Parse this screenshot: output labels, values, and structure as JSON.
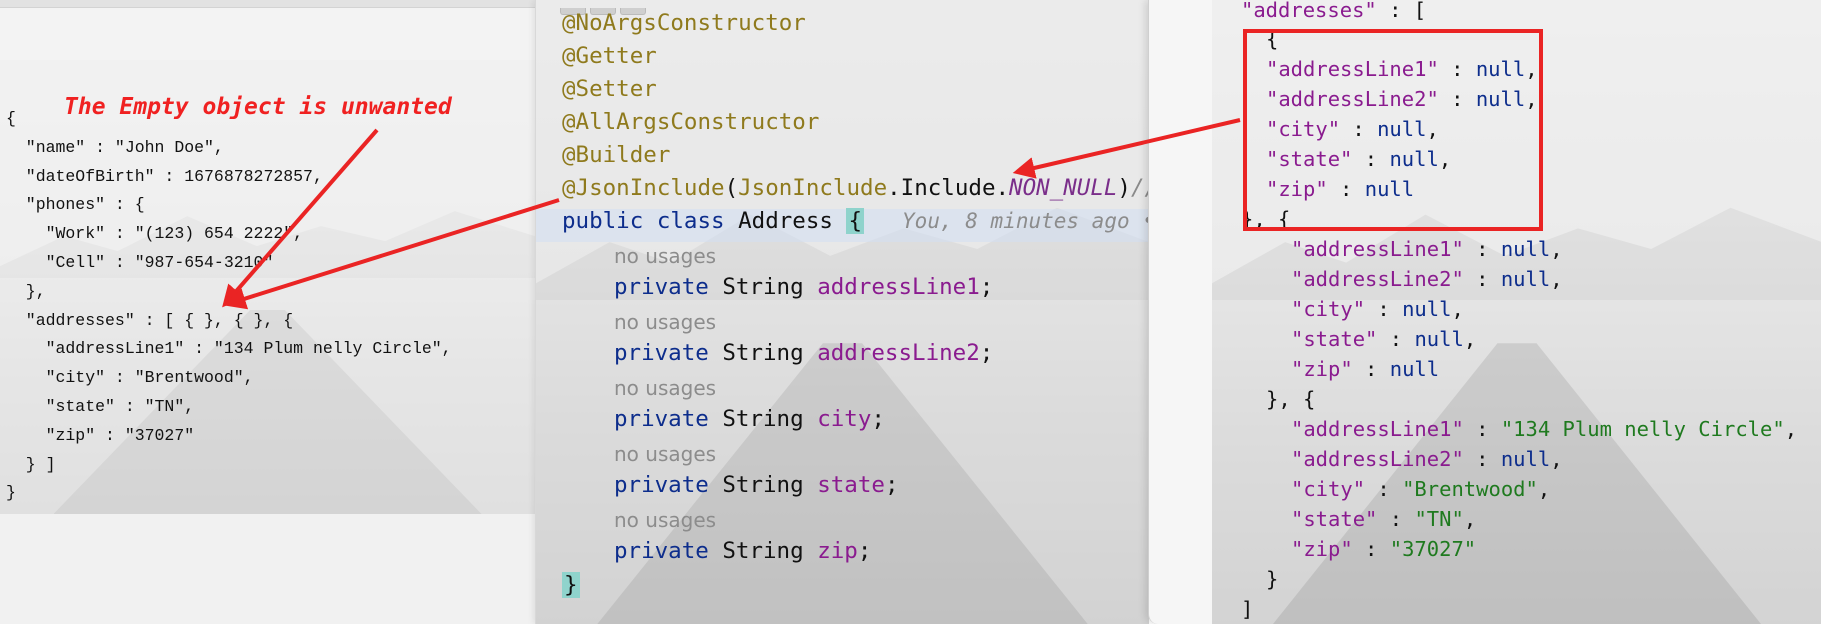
{
  "left": {
    "annotation": "The Empty object is unwanted",
    "code": "{\n  \"name\" : \"John Doe\",\n  \"dateOfBirth\" : 1676878272857,\n  \"phones\" : {\n    \"Work\" : \"(123) 654 2222\",\n    \"Cell\" : \"987-654-3210\"\n  },\n  \"addresses\" : [ { }, { }, {\n    \"addressLine1\" : \"134 Plum nelly Circle\",\n    \"city\" : \"Brentwood\",\n    \"state\" : \"TN\",\n    \"zip\" : \"37027\"\n  } ]\n}"
  },
  "editor": {
    "annotations": [
      "@NoArgsConstructor",
      "@Getter",
      "@Setter",
      "@AllArgsConstructor",
      "@Builder"
    ],
    "json_include": {
      "annotation": "@JsonInclude",
      "open_paren": "(",
      "class_ref": "JsonInclude",
      "member": ".Include.",
      "constant": "NON_NULL",
      "close_paren": ")",
      "comment": "//Do"
    },
    "class_decl": {
      "modifiers": "public class",
      "name": " Address ",
      "open_brace": "{",
      "blame": "You, 8 minutes ago •"
    },
    "usage_hint": "no usages",
    "fields": [
      {
        "modifiers": "private",
        "type": " String ",
        "name": "addressLine1",
        "semicolon": ";"
      },
      {
        "modifiers": "private",
        "type": " String ",
        "name": "addressLine2",
        "semicolon": ";"
      },
      {
        "modifiers": "private",
        "type": " String ",
        "name": "city",
        "semicolon": ";"
      },
      {
        "modifiers": "private",
        "type": " String ",
        "name": "state",
        "semicolon": ";"
      },
      {
        "modifiers": "private",
        "type": " String ",
        "name": "zip",
        "semicolon": ";"
      }
    ],
    "close_brace": "}"
  },
  "right": {
    "addresses_key": "\"addresses\"",
    "colon": " : ",
    "open_bracket": "[",
    "open_obj": "{",
    "obj_sep": "}, {",
    "close_obj": "}",
    "close_bracket": "]",
    "comma": ",",
    "null_word": "null",
    "keys": [
      "\"addressLine1\"",
      "\"addressLine2\"",
      "\"city\"",
      "\"state\"",
      "\"zip\""
    ],
    "third_values": [
      "\"134 Plum nelly Circle\"",
      "null",
      "\"Brentwood\"",
      "\"TN\"",
      "\"37027\""
    ]
  },
  "colors": {
    "arrow_red": "#ea2424",
    "annotation_red": "#f02121",
    "keyword_blue": "#0d2d8c",
    "field_purple": "#8a1b8f",
    "annotation_olive": "#8f7a1d",
    "string_green": "#1f7a1f",
    "brace_highlight": "#8fd3cc"
  }
}
